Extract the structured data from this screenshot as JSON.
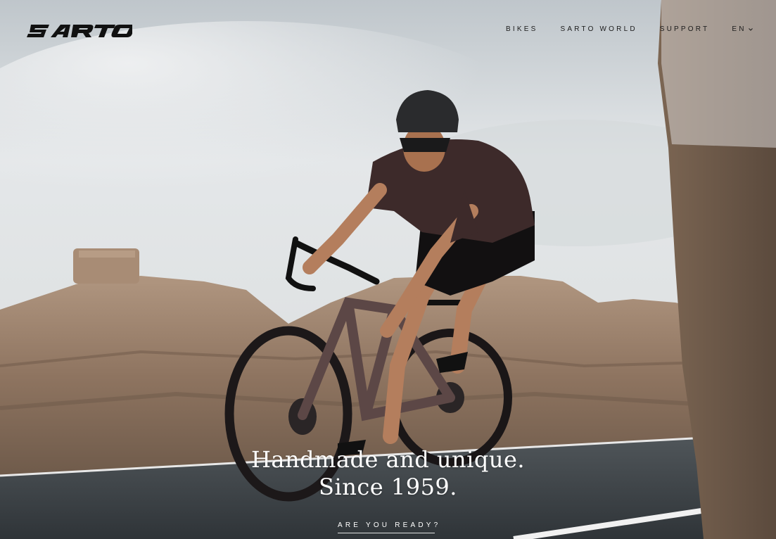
{
  "brand": {
    "logo_text": "SARTO"
  },
  "nav": {
    "items": [
      {
        "label": "BIKES"
      },
      {
        "label": "SARTO WORLD"
      },
      {
        "label": "SUPPORT"
      }
    ],
    "language": {
      "label": "EN",
      "icon": "chevron-down-icon"
    }
  },
  "hero": {
    "headline_line1": "Handmade and unique.",
    "headline_line2": "Since 1959.",
    "cta_label": "ARE YOU READY?"
  },
  "colors": {
    "sky": "#e6e9eb",
    "rock": "#9c806a",
    "road": "#3d4246",
    "jersey": "#3d2a2a",
    "text_dark": "#1b1b1b",
    "text_light": "#ffffff"
  }
}
